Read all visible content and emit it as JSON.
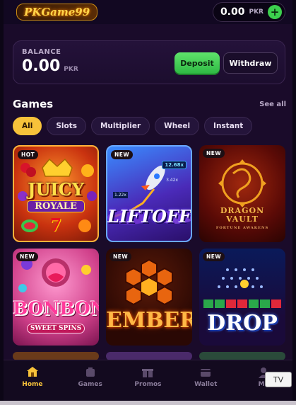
{
  "header": {
    "logo_text": "PKGame99",
    "balance_amount": "0.00",
    "currency": "PKR",
    "plus_symbol": "+"
  },
  "balance": {
    "label": "BALANCE",
    "amount": "0.00",
    "currency": "PKR",
    "deposit_label": "Deposit",
    "withdraw_label": "Withdraw"
  },
  "games": {
    "title": "Games",
    "see_all": "See all",
    "filters": [
      "All",
      "Slots",
      "Multiplier",
      "Wheel",
      "Instant"
    ],
    "active_filter": "All",
    "items": [
      {
        "title_line1": "JUICY",
        "title_line2": "ROYALE",
        "extra": "7",
        "badge": "HOT"
      },
      {
        "title_line1": "LIFTOFF",
        "title_line2": "",
        "extra": "12.68x",
        "extra2": "3.42x",
        "extra3": "1.22x",
        "badge": "NEW"
      },
      {
        "title_line1": "DRAGON",
        "title_line2": "VAULT",
        "extra": "FORTUNE AWAKENS",
        "badge": "NEW"
      },
      {
        "title_line1": "BONBON",
        "title_line2": "SWEET SPINS",
        "badge": "NEW"
      },
      {
        "title_line1": "EMBER",
        "title_line2": "",
        "badge": "NEW"
      },
      {
        "title_line1": "DROP",
        "title_line2": "",
        "badge": "NEW"
      }
    ]
  },
  "nav": {
    "items": [
      {
        "label": "Home",
        "icon": "home-icon"
      },
      {
        "label": "Games",
        "icon": "games-icon"
      },
      {
        "label": "Promos",
        "icon": "gift-icon"
      },
      {
        "label": "Wallet",
        "icon": "wallet-icon"
      },
      {
        "label": "Me",
        "icon": "user-icon"
      }
    ],
    "active": "Home"
  },
  "overlay": {
    "tv_label": "TV"
  },
  "colors": {
    "accent": "#f7c23a",
    "deposit": "#3fcf52",
    "background": "#1a0b2a"
  }
}
